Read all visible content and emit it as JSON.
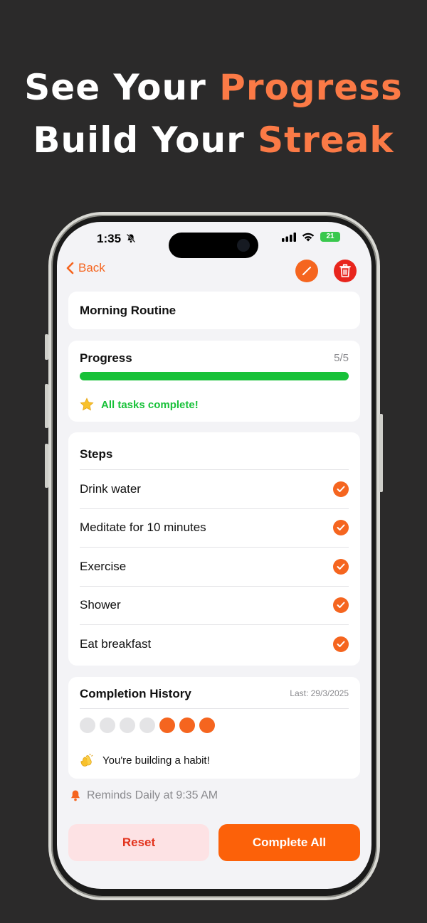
{
  "headline": {
    "line1_prefix": "See Your",
    "line1_accent": "Progress",
    "line2_prefix": "Build Your",
    "line2_accent": "Streak"
  },
  "status_bar": {
    "time": "1:35",
    "battery": "21"
  },
  "nav": {
    "back_label": "Back"
  },
  "routine": {
    "title": "Morning Routine"
  },
  "progress": {
    "title": "Progress",
    "count": "5/5",
    "completed": 5,
    "total": 5,
    "message": "All tasks complete!"
  },
  "steps": {
    "title": "Steps",
    "items": [
      {
        "label": "Drink water",
        "done": true
      },
      {
        "label": "Meditate for 10 minutes",
        "done": true
      },
      {
        "label": "Exercise",
        "done": true
      },
      {
        "label": "Shower",
        "done": true
      },
      {
        "label": "Eat breakfast",
        "done": true
      }
    ]
  },
  "history": {
    "title": "Completion History",
    "last": "Last: 29/3/2025",
    "days": [
      false,
      false,
      false,
      false,
      true,
      true,
      true
    ],
    "message": "You're building a habit!"
  },
  "reminder": {
    "text": "Reminds Daily at 9:35 AM"
  },
  "actions": {
    "reset_label": "Reset",
    "complete_label": "Complete All"
  },
  "colors": {
    "accent": "#f5651f",
    "headline_accent": "#fb7a46",
    "progress_fill": "#18c139",
    "delete_red": "#e8251d",
    "reset_bg": "#fde2e4",
    "reset_text": "#e2321c",
    "dot_inactive": "#e4e4e6"
  }
}
